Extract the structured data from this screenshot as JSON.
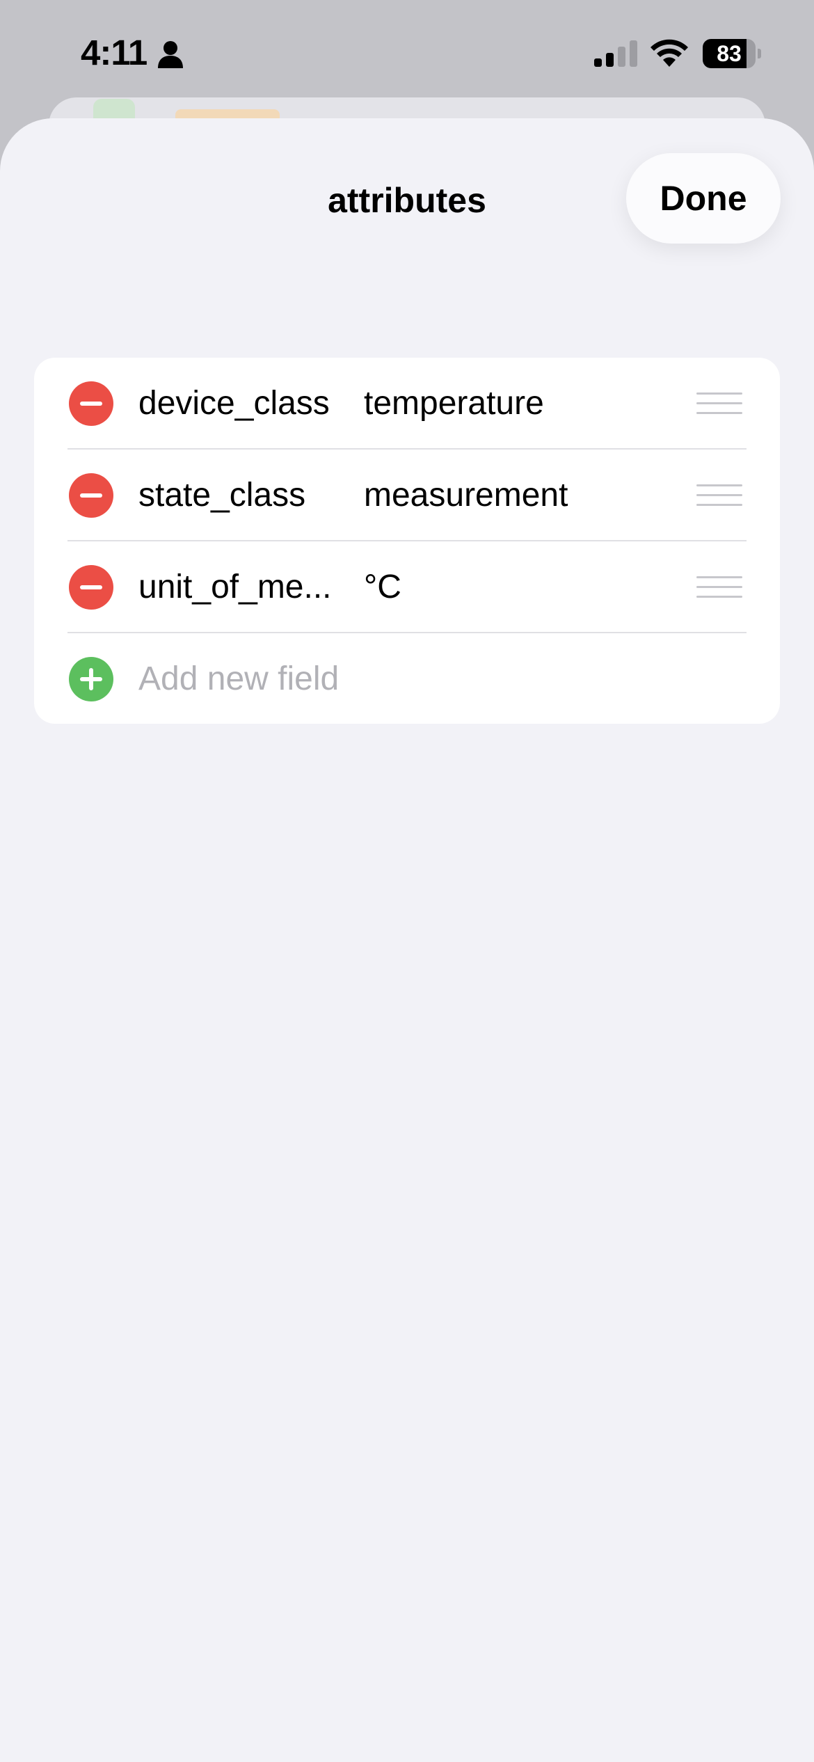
{
  "status_bar": {
    "time": "4:11",
    "battery_level": "83",
    "battery_fraction": 0.83,
    "icons": [
      "person-icon",
      "cellular-signal-icon",
      "wifi-icon",
      "battery-icon"
    ]
  },
  "sheet": {
    "title": "attributes",
    "done_label": "Done"
  },
  "fields": [
    {
      "key": "device_class",
      "value": "temperature"
    },
    {
      "key": "state_class",
      "value": "measurement"
    },
    {
      "key": "unit_of_me...",
      "value": "°C"
    }
  ],
  "add_field": {
    "placeholder": "Add new field"
  },
  "colors": {
    "remove": "#eb4e45",
    "add": "#5cbf5e",
    "sheet_background": "#f2f2f7",
    "card_background": "#ffffff",
    "placeholder_text": "#b1b1b6"
  }
}
